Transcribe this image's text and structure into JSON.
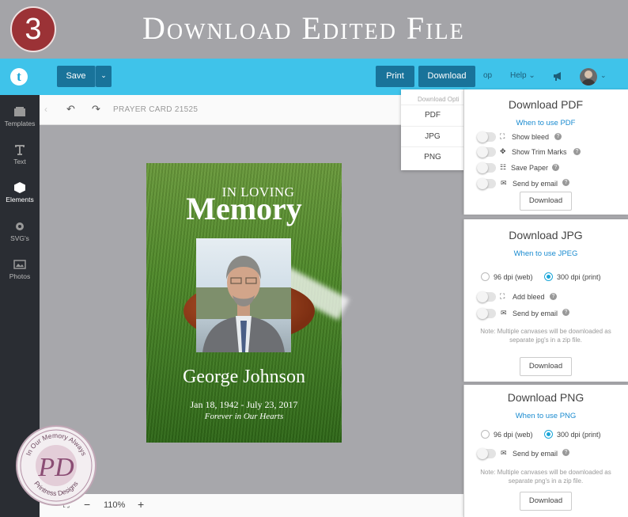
{
  "banner": {
    "step": "3",
    "title": "Download Edited File"
  },
  "header": {
    "logo": "t",
    "save_label": "Save",
    "print_label": "Print",
    "download_label": "Download",
    "op_text": "op",
    "help_label": "Help",
    "icons": [
      "megaphone-icon",
      "avatar",
      "chevron-down-icon"
    ]
  },
  "sidebar": {
    "items": [
      {
        "label": "Templates",
        "icon": "templates-icon"
      },
      {
        "label": "Text",
        "icon": "text-icon"
      },
      {
        "label": "Elements",
        "icon": "elements-icon"
      },
      {
        "label": "SVG's",
        "icon": "gear-icon"
      },
      {
        "label": "Photos",
        "icon": "photo-icon"
      }
    ]
  },
  "toolbar": {
    "doc_name": "PRAYER CARD 21525"
  },
  "card": {
    "in_loving": "IN LOVING",
    "memory": "Memory",
    "name": "George Johnson",
    "dates": "Jan 18, 1942 - July 23, 2017",
    "subtitle": "Forever in Our Hearts"
  },
  "zoom": {
    "level": "110%",
    "minus": "−",
    "plus": "+"
  },
  "seal": {
    "top": "In Our Memory Always",
    "bottom": "Printress Designs"
  },
  "download_menu": {
    "heading": "Download Opti",
    "options": [
      "PDF",
      "JPG",
      "PNG"
    ]
  },
  "panels": {
    "pdf": {
      "title": "Download PDF",
      "link": "When to use PDF",
      "options": [
        "Show bleed",
        "Show Trim Marks",
        "Save Paper",
        "Send by email"
      ],
      "button": "Download"
    },
    "jpg": {
      "title": "Download JPG",
      "link": "When to use JPEG",
      "dpi_web": "96 dpi (web)",
      "dpi_print": "300 dpi (print)",
      "options": [
        "Add bleed",
        "Send by email"
      ],
      "note": "Note: Multiple canvases will be downloaded as separate jpg's in a zip file.",
      "button": "Download"
    },
    "png": {
      "title": "Download PNG",
      "link": "When to use PNG",
      "dpi_web": "96 dpi (web)",
      "dpi_print": "300 dpi (print)",
      "options": [
        "Send by email"
      ],
      "note": "Note: Multiple canvases will be downloaded as separate png's in a zip file.",
      "button": "Download"
    }
  },
  "colors": {
    "accent": "#3fc3ea",
    "button": "#19739a",
    "step_badge": "#9b3236",
    "sidebar": "#2a2d33"
  }
}
